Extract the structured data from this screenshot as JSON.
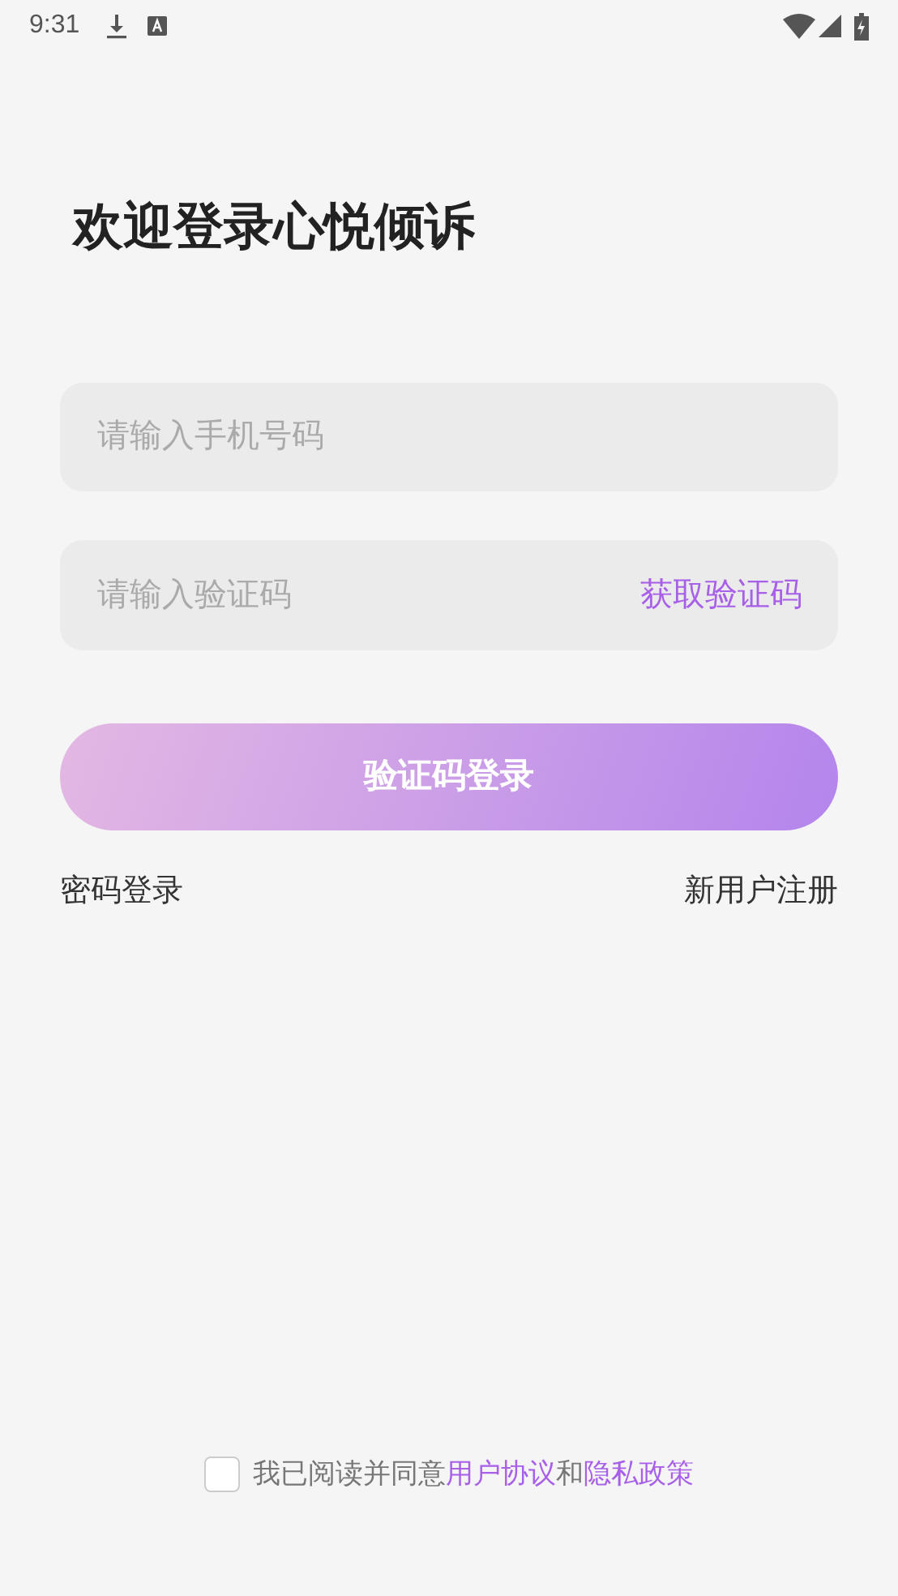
{
  "status_bar": {
    "time": "9:31"
  },
  "title": "欢迎登录心悦倾诉",
  "phone_field": {
    "placeholder": "请输入手机号码"
  },
  "code_field": {
    "placeholder": "请输入验证码",
    "action": "获取验证码"
  },
  "login_button": "验证码登录",
  "links": {
    "password_login": "密码登录",
    "register": "新用户注册"
  },
  "agreement": {
    "checked": false,
    "parts": [
      {
        "kind": "text",
        "text": "我已阅读并同意"
      },
      {
        "kind": "link",
        "text": "用户协议"
      },
      {
        "kind": "text",
        "text": "和"
      },
      {
        "kind": "link",
        "text": "隐私政策"
      }
    ]
  }
}
